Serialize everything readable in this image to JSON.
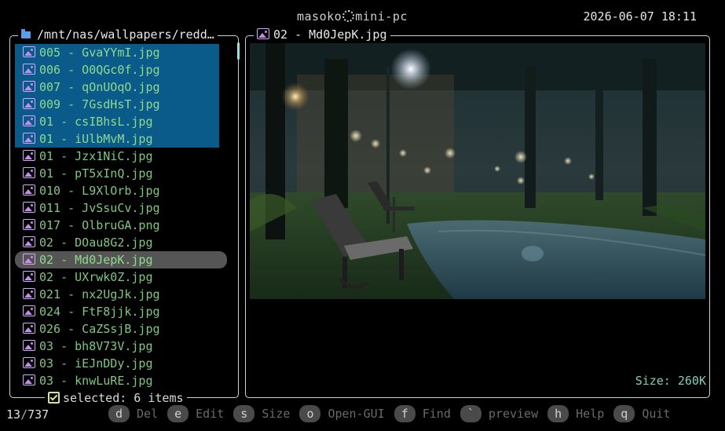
{
  "header": {
    "user": "masoko",
    "host": "mini-pc",
    "clock": "2026-06-07 18:11"
  },
  "left_panel": {
    "path": "/mnt/nas/wallpapers/redd…",
    "selected_label": "selected: 6 items",
    "files": [
      {
        "name": "005 - GvaYYmI.jpg",
        "state": "selected"
      },
      {
        "name": "006 - O0QGc0f.jpg",
        "state": "selected"
      },
      {
        "name": "007 - qOnUOqO.jpg",
        "state": "selected"
      },
      {
        "name": "009 - 7GsdHsT.jpg",
        "state": "selected"
      },
      {
        "name": "01 - csIBhsL.jpg",
        "state": "selected"
      },
      {
        "name": "01 - iUlbMvM.jpg",
        "state": "selected"
      },
      {
        "name": "01 - Jzx1NiC.jpg",
        "state": "normal"
      },
      {
        "name": "01 - pT5xInQ.jpg",
        "state": "normal"
      },
      {
        "name": "010 - L9XlOrb.jpg",
        "state": "normal"
      },
      {
        "name": "011 - JvSsuCv.jpg",
        "state": "normal"
      },
      {
        "name": "017 - OlbruGA.png",
        "state": "normal"
      },
      {
        "name": "02 - DOau8G2.jpg",
        "state": "normal"
      },
      {
        "name": "02 - Md0JepK.jpg",
        "state": "cursor"
      },
      {
        "name": "02 - UXrwk0Z.jpg",
        "state": "normal"
      },
      {
        "name": "021 - nx2UgJk.jpg",
        "state": "normal"
      },
      {
        "name": "024 - FtF8jjk.jpg",
        "state": "normal"
      },
      {
        "name": "026 - CaZSsjB.jpg",
        "state": "normal"
      },
      {
        "name": "03 - bh8V73V.jpg",
        "state": "normal"
      },
      {
        "name": "03 - iEJnDDy.jpg",
        "state": "normal"
      },
      {
        "name": "03 - knwLuRE.jpg",
        "state": "normal"
      }
    ]
  },
  "preview": {
    "title": "02 - Md0JepK.jpg",
    "size_label": "Size: 260K"
  },
  "status": {
    "position": "13",
    "total": "737",
    "keys": [
      {
        "key": "d",
        "label": "Del"
      },
      {
        "key": "e",
        "label": "Edit"
      },
      {
        "key": "s",
        "label": "Size"
      },
      {
        "key": "o",
        "label": "Open-GUI"
      },
      {
        "key": "f",
        "label": "Find"
      },
      {
        "key": "`",
        "label": "preview"
      },
      {
        "key": "h",
        "label": "Help"
      },
      {
        "key": "q",
        "label": "Quit"
      }
    ]
  },
  "colors": {
    "selection": "#0a5a8a",
    "cursor": "#555555",
    "filename": "#7fc77f",
    "icon": "#c58cf0",
    "folder": "#5aa0e8"
  }
}
